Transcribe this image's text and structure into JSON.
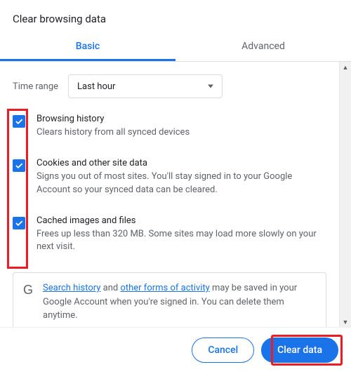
{
  "dialog": {
    "title": "Clear browsing data",
    "tabs": {
      "basic": "Basic",
      "advanced": "Advanced"
    },
    "timeRange": {
      "label": "Time range",
      "value": "Last hour"
    },
    "items": [
      {
        "title": "Browsing history",
        "desc": "Clears history from all synced devices"
      },
      {
        "title": "Cookies and other site data",
        "desc": "Signs you out of most sites. You'll stay signed in to your Google Account so your synced data can be cleared."
      },
      {
        "title": "Cached images and files",
        "desc": "Frees up less than 320 MB. Some sites may load more slowly on your next visit."
      }
    ],
    "info": {
      "link1": "Search history",
      "mid1": " and ",
      "link2": "other forms of activity",
      "rest": " may be saved in your Google Account when you're signed in. You can delete them anytime."
    },
    "buttons": {
      "cancel": "Cancel",
      "clear": "Clear data"
    }
  }
}
